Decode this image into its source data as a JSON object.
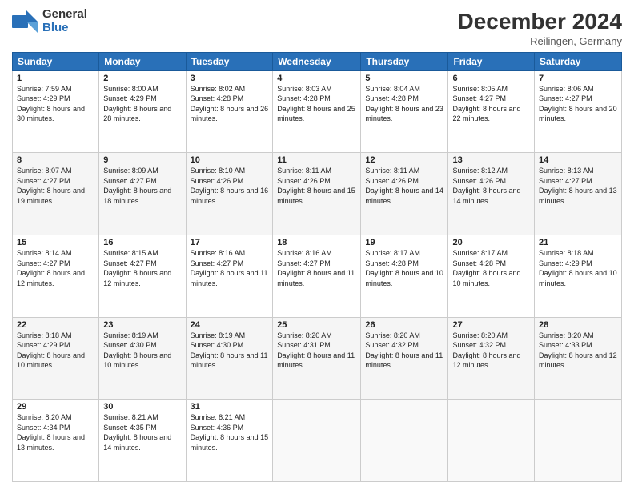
{
  "header": {
    "logo_line1": "General",
    "logo_line2": "Blue",
    "month": "December 2024",
    "location": "Reilingen, Germany"
  },
  "days_of_week": [
    "Sunday",
    "Monday",
    "Tuesday",
    "Wednesday",
    "Thursday",
    "Friday",
    "Saturday"
  ],
  "weeks": [
    [
      {
        "day": "1",
        "sunrise": "7:59 AM",
        "sunset": "4:29 PM",
        "daylight": "8 hours and 30 minutes."
      },
      {
        "day": "2",
        "sunrise": "8:00 AM",
        "sunset": "4:29 PM",
        "daylight": "8 hours and 28 minutes."
      },
      {
        "day": "3",
        "sunrise": "8:02 AM",
        "sunset": "4:28 PM",
        "daylight": "8 hours and 26 minutes."
      },
      {
        "day": "4",
        "sunrise": "8:03 AM",
        "sunset": "4:28 PM",
        "daylight": "8 hours and 25 minutes."
      },
      {
        "day": "5",
        "sunrise": "8:04 AM",
        "sunset": "4:28 PM",
        "daylight": "8 hours and 23 minutes."
      },
      {
        "day": "6",
        "sunrise": "8:05 AM",
        "sunset": "4:27 PM",
        "daylight": "8 hours and 22 minutes."
      },
      {
        "day": "7",
        "sunrise": "8:06 AM",
        "sunset": "4:27 PM",
        "daylight": "8 hours and 20 minutes."
      }
    ],
    [
      {
        "day": "8",
        "sunrise": "8:07 AM",
        "sunset": "4:27 PM",
        "daylight": "8 hours and 19 minutes."
      },
      {
        "day": "9",
        "sunrise": "8:09 AM",
        "sunset": "4:27 PM",
        "daylight": "8 hours and 18 minutes."
      },
      {
        "day": "10",
        "sunrise": "8:10 AM",
        "sunset": "4:26 PM",
        "daylight": "8 hours and 16 minutes."
      },
      {
        "day": "11",
        "sunrise": "8:11 AM",
        "sunset": "4:26 PM",
        "daylight": "8 hours and 15 minutes."
      },
      {
        "day": "12",
        "sunrise": "8:11 AM",
        "sunset": "4:26 PM",
        "daylight": "8 hours and 14 minutes."
      },
      {
        "day": "13",
        "sunrise": "8:12 AM",
        "sunset": "4:26 PM",
        "daylight": "8 hours and 14 minutes."
      },
      {
        "day": "14",
        "sunrise": "8:13 AM",
        "sunset": "4:27 PM",
        "daylight": "8 hours and 13 minutes."
      }
    ],
    [
      {
        "day": "15",
        "sunrise": "8:14 AM",
        "sunset": "4:27 PM",
        "daylight": "8 hours and 12 minutes."
      },
      {
        "day": "16",
        "sunrise": "8:15 AM",
        "sunset": "4:27 PM",
        "daylight": "8 hours and 12 minutes."
      },
      {
        "day": "17",
        "sunrise": "8:16 AM",
        "sunset": "4:27 PM",
        "daylight": "8 hours and 11 minutes."
      },
      {
        "day": "18",
        "sunrise": "8:16 AM",
        "sunset": "4:27 PM",
        "daylight": "8 hours and 11 minutes."
      },
      {
        "day": "19",
        "sunrise": "8:17 AM",
        "sunset": "4:28 PM",
        "daylight": "8 hours and 10 minutes."
      },
      {
        "day": "20",
        "sunrise": "8:17 AM",
        "sunset": "4:28 PM",
        "daylight": "8 hours and 10 minutes."
      },
      {
        "day": "21",
        "sunrise": "8:18 AM",
        "sunset": "4:29 PM",
        "daylight": "8 hours and 10 minutes."
      }
    ],
    [
      {
        "day": "22",
        "sunrise": "8:18 AM",
        "sunset": "4:29 PM",
        "daylight": "8 hours and 10 minutes."
      },
      {
        "day": "23",
        "sunrise": "8:19 AM",
        "sunset": "4:30 PM",
        "daylight": "8 hours and 10 minutes."
      },
      {
        "day": "24",
        "sunrise": "8:19 AM",
        "sunset": "4:30 PM",
        "daylight": "8 hours and 11 minutes."
      },
      {
        "day": "25",
        "sunrise": "8:20 AM",
        "sunset": "4:31 PM",
        "daylight": "8 hours and 11 minutes."
      },
      {
        "day": "26",
        "sunrise": "8:20 AM",
        "sunset": "4:32 PM",
        "daylight": "8 hours and 11 minutes."
      },
      {
        "day": "27",
        "sunrise": "8:20 AM",
        "sunset": "4:32 PM",
        "daylight": "8 hours and 12 minutes."
      },
      {
        "day": "28",
        "sunrise": "8:20 AM",
        "sunset": "4:33 PM",
        "daylight": "8 hours and 12 minutes."
      }
    ],
    [
      {
        "day": "29",
        "sunrise": "8:20 AM",
        "sunset": "4:34 PM",
        "daylight": "8 hours and 13 minutes."
      },
      {
        "day": "30",
        "sunrise": "8:21 AM",
        "sunset": "4:35 PM",
        "daylight": "8 hours and 14 minutes."
      },
      {
        "day": "31",
        "sunrise": "8:21 AM",
        "sunset": "4:36 PM",
        "daylight": "8 hours and 15 minutes."
      },
      null,
      null,
      null,
      null
    ]
  ],
  "labels": {
    "sunrise": "Sunrise:",
    "sunset": "Sunset:",
    "daylight": "Daylight:"
  }
}
